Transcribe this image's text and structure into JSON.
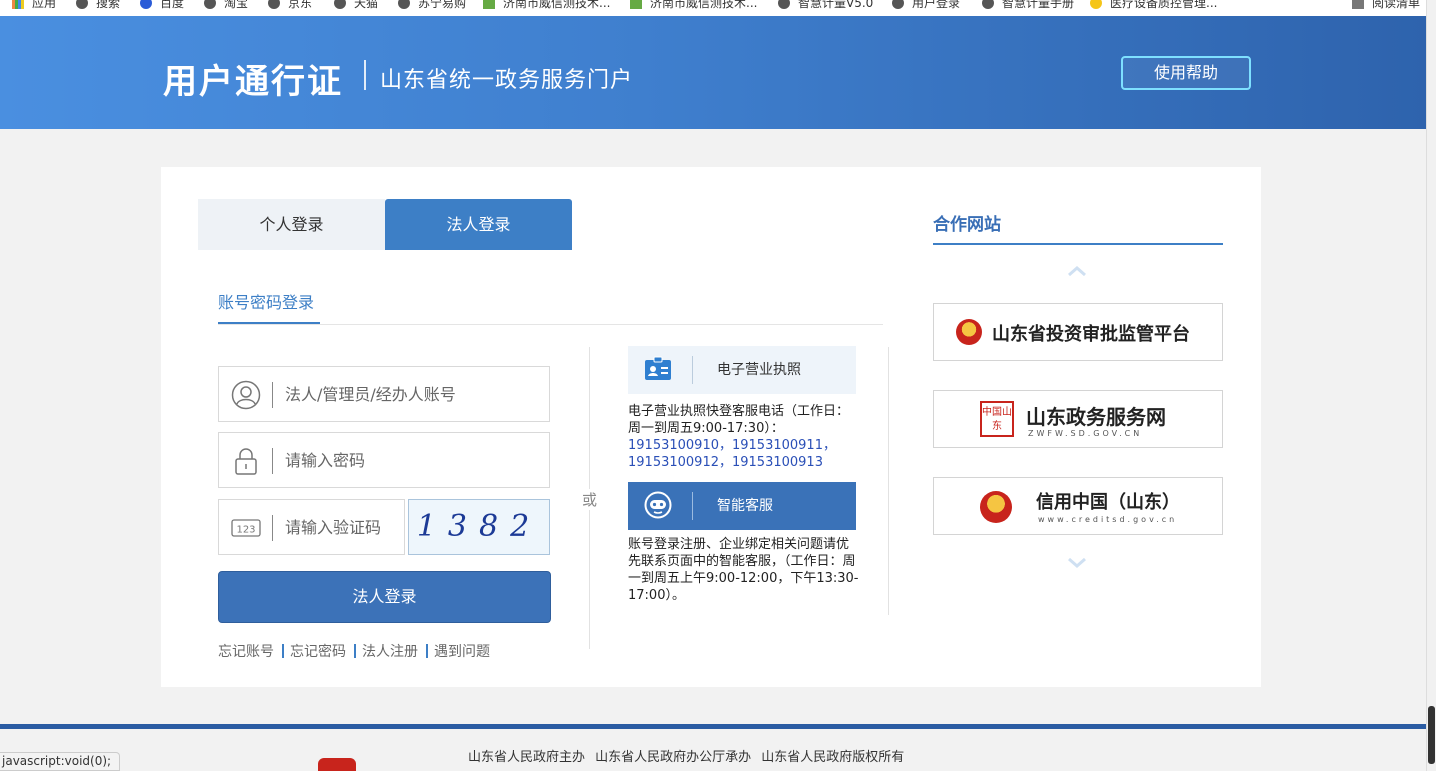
{
  "bookmarks": [
    {
      "label": "应用",
      "icon": "apps-grid-icon"
    },
    {
      "label": "搜索",
      "icon": "globe-icon"
    },
    {
      "label": "百度",
      "icon": "baidu-paw-icon"
    },
    {
      "label": "淘宝",
      "icon": "globe-icon"
    },
    {
      "label": "京东",
      "icon": "globe-icon"
    },
    {
      "label": "天猫",
      "icon": "globe-icon"
    },
    {
      "label": "苏宁易购",
      "icon": "globe-icon"
    },
    {
      "label": "济南市威信测技术...",
      "icon": "doc-icon"
    },
    {
      "label": "济南市威信测技术...",
      "icon": "doc-icon"
    },
    {
      "label": "智慧计量V5.0",
      "icon": "globe-icon"
    },
    {
      "label": "用户登录",
      "icon": "globe-icon"
    },
    {
      "label": "智慧计量手册",
      "icon": "globe-icon"
    },
    {
      "label": "医疗设备质控管理...",
      "icon": "folder-icon"
    },
    {
      "label": "阅读清单",
      "icon": "reading-list-icon"
    }
  ],
  "header": {
    "title": "用户通行证",
    "subtitle": "山东省统一政务服务门户",
    "help_label": "使用帮助"
  },
  "tabs": [
    {
      "label": "个人登录",
      "active": false
    },
    {
      "label": "法人登录",
      "active": true
    }
  ],
  "login": {
    "method_label": "账号密码登录",
    "account_placeholder": "法人/管理员/经办人账号",
    "password_placeholder": "请输入密码",
    "captcha_placeholder": "请输入验证码",
    "captcha_code": "1382",
    "submit_label": "法人登录",
    "links": [
      "忘记账号",
      "忘记密码",
      "法人注册",
      "遇到问题"
    ],
    "or_label": "或"
  },
  "services": {
    "license": {
      "label": "电子营业执照",
      "text": "电子营业执照快登客服电话（工作日：周一到周五9:00-17:30）：",
      "phones": "19153100910，19153100911，19153100912，19153100913"
    },
    "ai": {
      "label": "智能客服",
      "text": "账号登录注册、企业绑定相关问题请优先联系页面中的智能客服，（工作日：周一到周五上午9:00-12:00，下午13:30-17:00）。"
    }
  },
  "partners": {
    "title": "合作网站",
    "items": [
      {
        "name": "山东省投资审批监管平台",
        "url": ""
      },
      {
        "name": "山东政务服务网",
        "url": "ZWFW.SD.GOV.CN",
        "seal": "中国山东"
      },
      {
        "name": "信用中国（山东）",
        "url": "www.creditsd.gov.cn"
      }
    ]
  },
  "footer": {
    "text": "山东省人民政府主办 山东省人民政府办公厅承办 山东省人民政府版权所有"
  },
  "status_bar": "javascript:void(0);",
  "colors": {
    "primary": "#3d7fc6",
    "header_start": "#4a8fe0",
    "header_end": "#2e63ad",
    "help_border": "#7ee0ff",
    "phone": "#2a4fb7"
  }
}
